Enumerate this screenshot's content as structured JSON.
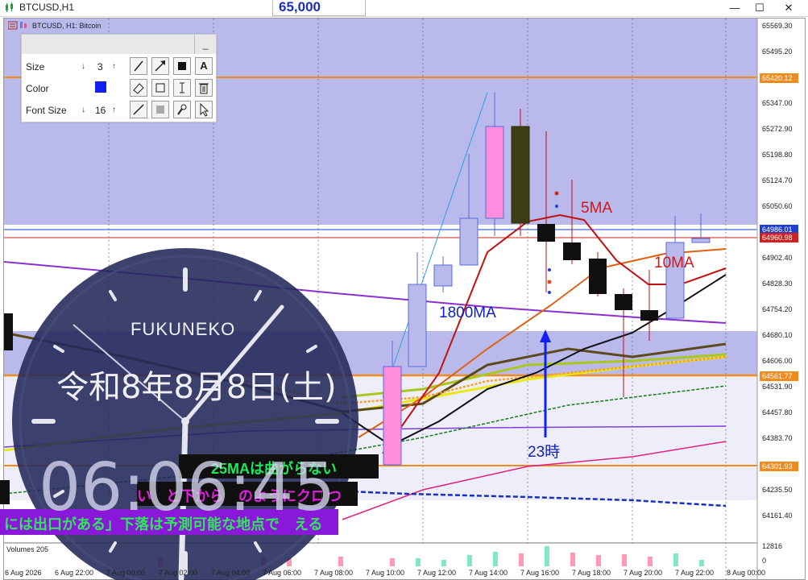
{
  "window": {
    "title": "BTCUSD,H1",
    "price_box": "65,000",
    "controls": [
      "minimize-icon",
      "maximize-icon",
      "close-icon"
    ]
  },
  "chart": {
    "symbol_label": "BTCUSD, H1: Bitcoin",
    "price_axis": [
      "65569.30",
      "65495.20",
      "65347.00",
      "65272.90",
      "65198.80",
      "65124.70",
      "65050.60",
      "64902.40",
      "64828.30",
      "64754.20",
      "64680.10",
      "64606.00",
      "64531.90",
      "64457.80",
      "64383.70",
      "64235.50",
      "64161.40"
    ],
    "price_tags": [
      {
        "label": "65420.12",
        "color": "#f08c1e"
      },
      {
        "label": "64986.01",
        "color": "#1e3fd0"
      },
      {
        "label": "64960.98",
        "color": "#d02020"
      },
      {
        "label": "64561.77",
        "color": "#f08c1e"
      },
      {
        "label": "64301.93",
        "color": "#f08c1e"
      }
    ],
    "time_axis": [
      "6 Aug 2026",
      "6 Aug 22:00",
      "7 Aug 00:00",
      "7 Aug 02:00",
      "7 Aug 04:00",
      "7 Aug 06:00",
      "7 Aug 08:00",
      "7 Aug 10:00",
      "7 Aug 12:00",
      "7 Aug 14:00",
      "7 Aug 16:00",
      "7 Aug 18:00",
      "7 Aug 20:00",
      "7 Aug 22:00",
      "8 Aug 00:00"
    ],
    "volume_label": "Volumes 205",
    "volume_axis": [
      "12816",
      "0"
    ]
  },
  "draw_panel": {
    "size_label": "Size",
    "size_value": "3",
    "color_label": "Color",
    "color_value": "#1020f0",
    "font_size_label": "Font Size",
    "font_size_value": "16",
    "minimize_label": "_",
    "tools": [
      "pencil-icon",
      "arrow-icon",
      "rect-fill-icon",
      "text-A-icon",
      "eraser-icon",
      "rect-outline-icon",
      "text-cursor-icon",
      "trash-icon",
      "line-icon",
      "gray-square-icon",
      "stamp-icon",
      "pointer-icon"
    ],
    "text_tool_label": "A"
  },
  "annotations": {
    "ma5": "5MA",
    "ma10": "10MA",
    "ma1800": "1800MA",
    "hour23": "23時",
    "banner_1": "25MAは曲がらない",
    "banner_2": "い　と下から　のようにクロスする",
    "banner_2_tail": "つ",
    "banner_3": "には出口がある」下落は予測可能な地点で　える"
  },
  "clock": {
    "brand": "FUKUNEKO",
    "date": "令和8年8月8日(土)",
    "time": "06:06:45"
  }
}
